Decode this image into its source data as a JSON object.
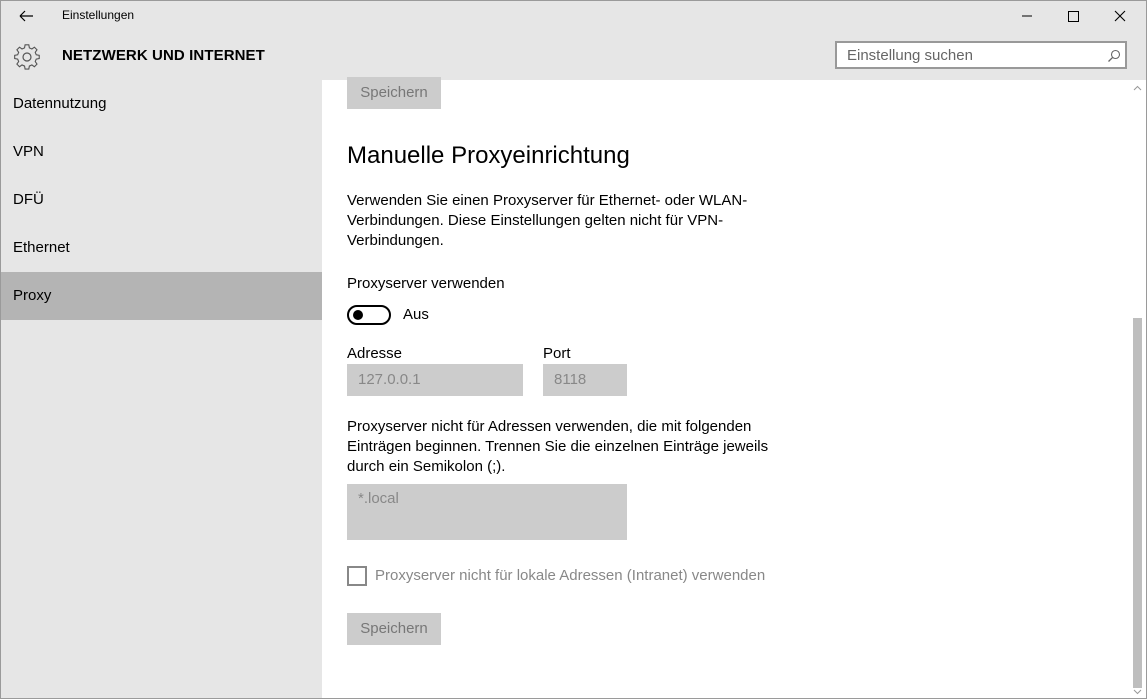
{
  "window": {
    "title": "Einstellungen"
  },
  "header": {
    "title": "NETZWERK UND INTERNET",
    "search_placeholder": "Einstellung suchen"
  },
  "sidebar": {
    "items": [
      {
        "label": "Datennutzung",
        "active": false
      },
      {
        "label": "VPN",
        "active": false
      },
      {
        "label": "DFÜ",
        "active": false
      },
      {
        "label": "Ethernet",
        "active": false
      },
      {
        "label": "Proxy",
        "active": true
      }
    ]
  },
  "content": {
    "top_save_label": "Speichern",
    "section_title": "Manuelle Proxyeinrichtung",
    "description": "Verwenden Sie einen Proxyserver für Ethernet- oder WLAN-Verbindungen. Diese Einstellungen gelten nicht für VPN-Verbindungen.",
    "use_proxy_label": "Proxyserver verwenden",
    "toggle_state": "Aus",
    "address_label": "Adresse",
    "address_value": "127.0.0.1",
    "port_label": "Port",
    "port_value": "8118",
    "exceptions_desc": "Proxyserver nicht für Adressen verwenden, die mit folgenden Einträgen beginnen. Trennen Sie die einzelnen Einträge jeweils durch ein Semikolon (;).",
    "exceptions_value": "*.local",
    "local_checkbox_label": "Proxyserver nicht für lokale Adressen (Intranet) verwenden",
    "bottom_save_label": "Speichern"
  },
  "colors": {
    "chrome_bg": "#e6e6e6",
    "active_nav": "#b4b4b4",
    "disabled_fill": "#cccccc"
  }
}
